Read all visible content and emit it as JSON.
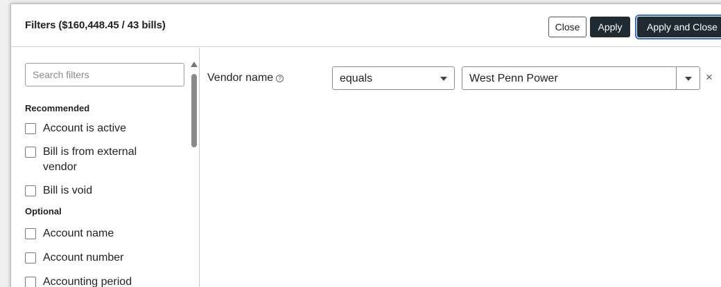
{
  "dialog": {
    "title": "Filters ($160,448.45 / 43 bills)",
    "buttons": {
      "close": "Close",
      "apply": "Apply",
      "apply_close": "Apply and Close"
    }
  },
  "sidebar": {
    "search_placeholder": "Search filters",
    "sections": {
      "recommended": {
        "label": "Recommended",
        "items": [
          "Account is active",
          "Bill is from external vendor",
          "Bill is void"
        ]
      },
      "optional": {
        "label": "Optional",
        "items": [
          "Account name",
          "Account number",
          "Accounting period"
        ]
      }
    }
  },
  "active_filter": {
    "name": "Vendor name",
    "help_icon": "?",
    "operator": "equals",
    "value": "West Penn Power",
    "remove_icon": "×"
  },
  "colors": {
    "primary_button": "#1f2a33",
    "focus_ring": "#2f6fd1"
  }
}
